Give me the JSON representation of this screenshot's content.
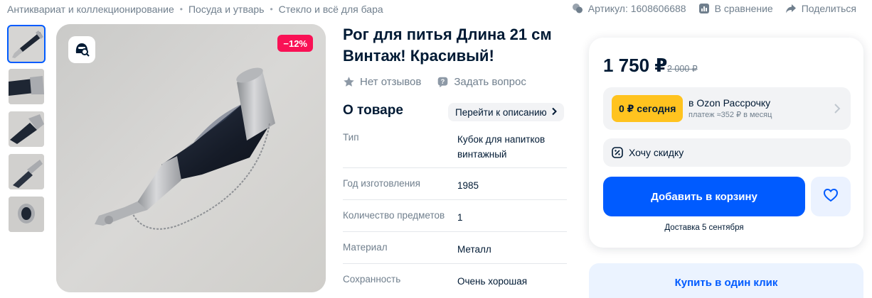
{
  "breadcrumbs": [
    "Антиквариат и коллекционирование",
    "Посуда и утварь",
    "Стекло и всё для бара"
  ],
  "breadcrumb_separator": "•",
  "meta": {
    "article": "Артикул: 1608606688",
    "compare": "В сравнение",
    "share": "Поделиться"
  },
  "gallery": {
    "discount_badge": "−12%",
    "thumbnail_count": 5,
    "active_thumbnail": 1
  },
  "product": {
    "title": "Рог для питья Длина 21 см Винтаж! Красивый!",
    "reviews": "Нет отзывов",
    "ask_question": "Задать вопрос",
    "about_heading": "О товаре",
    "to_description": "Перейти к описанию",
    "specs": [
      {
        "key": "Тип",
        "value": "Кубок для напитков винтажный"
      },
      {
        "key": "Год изготовления",
        "value": "1985"
      },
      {
        "key": "Количество предметов",
        "value": "1"
      },
      {
        "key": "Материал",
        "value": "Металл"
      },
      {
        "key": "Сохранность",
        "value": "Очень хорошая"
      }
    ]
  },
  "buy": {
    "price": "1 750 ₽",
    "old_price": "2 000 ₽",
    "installment_pill": "0 ₽ сегодня",
    "installment_title": "в Ozon Рассрочку",
    "installment_sub": "платеж ≈352 ₽ в месяц",
    "want_discount": "Хочу скидку",
    "add_to_cart": "Добавить в корзину",
    "delivery": "Доставка 5 сентября",
    "buy_one_click": "Купить в один клик"
  },
  "colors": {
    "accent": "#005bff",
    "discount": "#f91155",
    "installment": "#ffc31f",
    "muted_text": "#707f8d"
  },
  "icons": [
    "chat-icon",
    "compare-icon",
    "share-icon",
    "lens-search-icon",
    "star-icon",
    "question-icon",
    "chevron-right-icon",
    "discount-icon",
    "heart-icon"
  ]
}
